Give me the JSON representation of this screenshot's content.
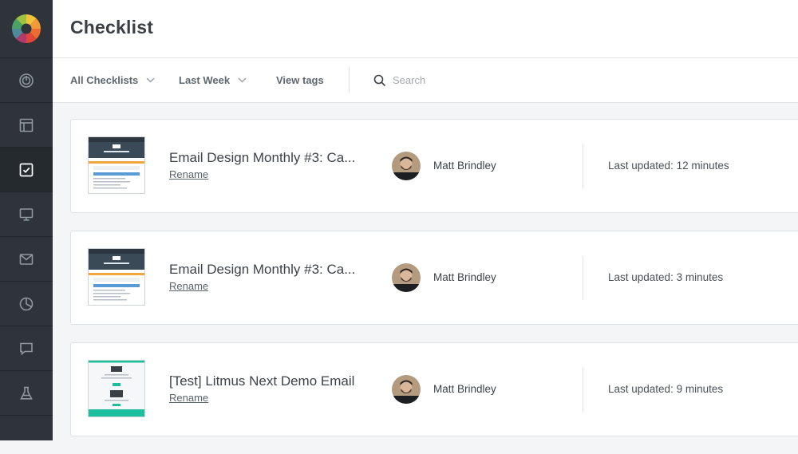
{
  "header": {
    "title": "Checklist"
  },
  "toolbar": {
    "filter_label": "All Checklists",
    "date_label": "Last Week",
    "tags_label": "View tags",
    "search_placeholder": "Search"
  },
  "sidebar": {
    "items": [
      {
        "icon": "dashboard-icon"
      },
      {
        "icon": "layout-icon"
      },
      {
        "icon": "checklist-icon",
        "active": true
      },
      {
        "icon": "monitor-icon"
      },
      {
        "icon": "mail-icon"
      },
      {
        "icon": "analytics-icon"
      },
      {
        "icon": "chat-icon"
      },
      {
        "icon": "flask-icon"
      }
    ]
  },
  "checklists": [
    {
      "title": "Email Design Monthly #3: Ca...",
      "rename_label": "Rename",
      "owner": "Matt Brindley",
      "updated": "Last updated: 12 minutes"
    },
    {
      "title": "Email Design Monthly #3: Ca...",
      "rename_label": "Rename",
      "owner": "Matt Brindley",
      "updated": "Last updated: 3 minutes"
    },
    {
      "title": "[Test] Litmus Next Demo Email",
      "rename_label": "Rename",
      "owner": "Matt Brindley",
      "updated": "Last updated: 9 minutes"
    }
  ],
  "colors": {
    "sidebar_bg": "#2e3439",
    "sidebar_active": "#242a2e",
    "icon_default": "#8f979f",
    "icon_active": "#ffffff",
    "thumb_header_dark": "#3b4a57",
    "thumb_accent_orange": "#f3a73b",
    "thumb_accent_blue": "#5b9bd5",
    "thumb_accent_teal": "#1dbf9f"
  }
}
